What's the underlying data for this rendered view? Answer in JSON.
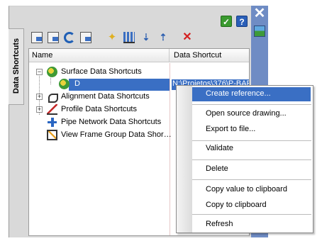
{
  "palette": {
    "title": "Data Shortcuts",
    "toolbar_icons": [
      "new-shortcut-icon",
      "edit-shortcut-icon",
      "refresh-icon",
      "validate-icon",
      "associate-icon",
      "sort-icon",
      "move-down-icon",
      "move-up-icon",
      "delete-icon"
    ],
    "top_buttons": {
      "ok_icon": "check-icon",
      "help_icon": "help-icon",
      "help_glyph": "?",
      "check_glyph": "✓"
    },
    "side": {
      "close_glyph": "✕",
      "icon": "picture-icon"
    },
    "colors": {
      "selection": "#3a6fc4",
      "side_strip": "#6f8cc4"
    }
  },
  "tree": {
    "columns": [
      "Name",
      "Data Shortcut"
    ],
    "rows": [
      {
        "label": "Surface Data Shortcuts",
        "icon": "surface-icon",
        "expander": "−"
      },
      {
        "label": "D",
        "icon": "surface-icon",
        "shortcut": "N:\\Projetos\\376\\P-BAR"
      },
      {
        "label": "Alignment Data Shortcuts",
        "icon": "alignment-icon",
        "expander": "+"
      },
      {
        "label": "Profile Data Shortcuts",
        "icon": "profile-icon",
        "expander": "+"
      },
      {
        "label": "Pipe Network Data Shortcuts",
        "icon": "pipe-network-icon"
      },
      {
        "label": "View Frame Group Data Shor…",
        "icon": "view-frame-icon"
      }
    ]
  },
  "context_menu": {
    "items": [
      "Create reference...",
      "Open source drawing...",
      "Export to file...",
      "Validate",
      "Delete",
      "Copy value to clipboard",
      "Copy to clipboard",
      "Refresh"
    ]
  }
}
